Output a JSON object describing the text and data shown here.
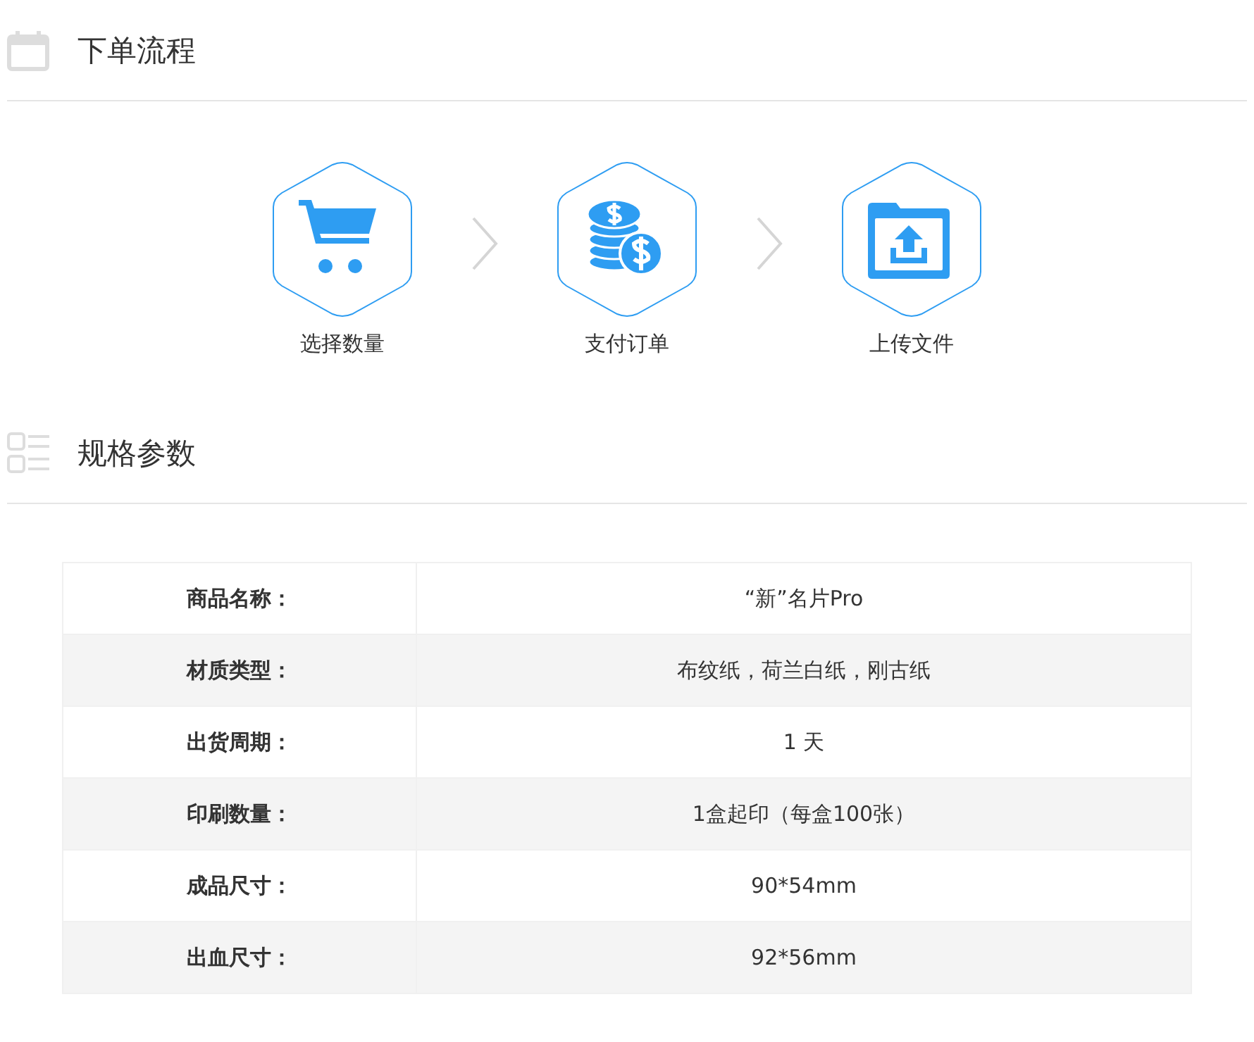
{
  "order_section": {
    "title": "下单流程",
    "kind": "calendar"
  },
  "steps": [
    {
      "kind": "cart",
      "label": "选择数量"
    },
    {
      "kind": "coins",
      "label": "支付订单"
    },
    {
      "kind": "upload",
      "label": "上传文件"
    }
  ],
  "spec_section": {
    "title": "规格参数",
    "kind": "list"
  },
  "spec_table": {
    "rows": [
      {
        "label": "商品名称：",
        "value": "“新”名片Pro"
      },
      {
        "label": "材质类型：",
        "value": "布纹纸，荷兰白纸，刚古纸"
      },
      {
        "label": "出货周期：",
        "value": "1 天"
      },
      {
        "label": "印刷数量：",
        "value": "1盒起印（每盒100张）"
      },
      {
        "label": "成品尺寸：",
        "value": "90*54mm"
      },
      {
        "label": "出血尺寸：",
        "value": "92*56mm"
      }
    ]
  }
}
